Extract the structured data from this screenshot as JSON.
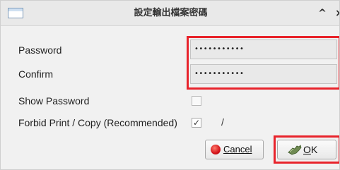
{
  "window": {
    "title": "設定輸出檔案密碼",
    "app_icon": "window-icon",
    "controls": {
      "collapse_glyph": "^",
      "close_glyph": "×"
    }
  },
  "form": {
    "password": {
      "label": "Password",
      "value": "•••••••••••"
    },
    "confirm": {
      "label": "Confirm",
      "value": "•••••••••••"
    },
    "show_password": {
      "label": "Show Password",
      "checked": false,
      "mark": ""
    },
    "forbid_print_copy": {
      "label": "Forbid Print / Copy (Recommended)",
      "checked": true,
      "mark": "✓",
      "extra": "/"
    }
  },
  "buttons": {
    "cancel": {
      "label": "Cancel",
      "icon": "red-circle-icon"
    },
    "ok": {
      "label_mnemonic": "O",
      "label_rest": "K",
      "icon": "ok-hand-icon"
    }
  },
  "highlights": {
    "color": "#e8232b"
  }
}
